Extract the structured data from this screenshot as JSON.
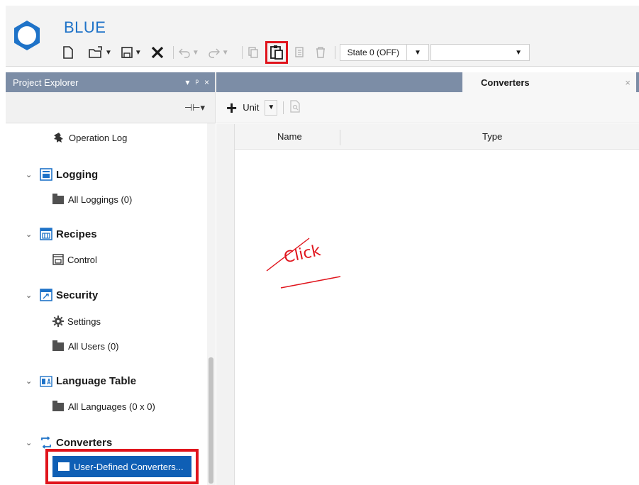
{
  "app": {
    "title": "BLUE",
    "brand_color": "#1f73c8"
  },
  "toolbar": {
    "state_value": "State 0 (OFF)",
    "state_dropdown_arrow": "▼",
    "extra_dropdown_arrow": "▼",
    "highlighted_button": "paste"
  },
  "explorer": {
    "title": "Project Explorer",
    "header_controls": [
      "▾",
      "ᵖ",
      "×"
    ],
    "tools_label": "⊣⊢▾",
    "tree": [
      {
        "kind": "leaf",
        "label": "Operation Log",
        "icon": "operation-log-icon"
      },
      {
        "kind": "group",
        "label": "Logging",
        "icon": "logging-icon"
      },
      {
        "kind": "leaf",
        "label": "All Loggings (0)",
        "icon": "folder-icon"
      },
      {
        "kind": "group",
        "label": "Recipes",
        "icon": "recipes-icon"
      },
      {
        "kind": "leaf",
        "label": "Control",
        "icon": "control-icon"
      },
      {
        "kind": "group",
        "label": "Security",
        "icon": "security-icon"
      },
      {
        "kind": "leaf",
        "label": "Settings",
        "icon": "gear-icon"
      },
      {
        "kind": "leaf",
        "label": "All Users (0)",
        "icon": "folder-icon"
      },
      {
        "kind": "group",
        "label": "Language Table",
        "icon": "language-table-icon"
      },
      {
        "kind": "leaf",
        "label": "All Languages (0 x 0)",
        "icon": "folder-icon"
      },
      {
        "kind": "group",
        "label": "Converters",
        "icon": "converters-icon"
      },
      {
        "kind": "leaf",
        "label": "User-Defined Converters...",
        "icon": "folder-icon",
        "selected": true
      }
    ]
  },
  "document": {
    "tab_label": "Converters",
    "tab_close": "×",
    "unit_button": "Unit",
    "unit_plus": "+",
    "unit_dropdown_arrow": "▼",
    "columns": [
      "Name",
      "Type"
    ]
  },
  "annotation": {
    "text": "Click",
    "color": "#e0141c"
  },
  "colors": {
    "panel_header": "#7c8da6",
    "selection": "#0f5fb5",
    "highlight_box": "#e0141c"
  }
}
